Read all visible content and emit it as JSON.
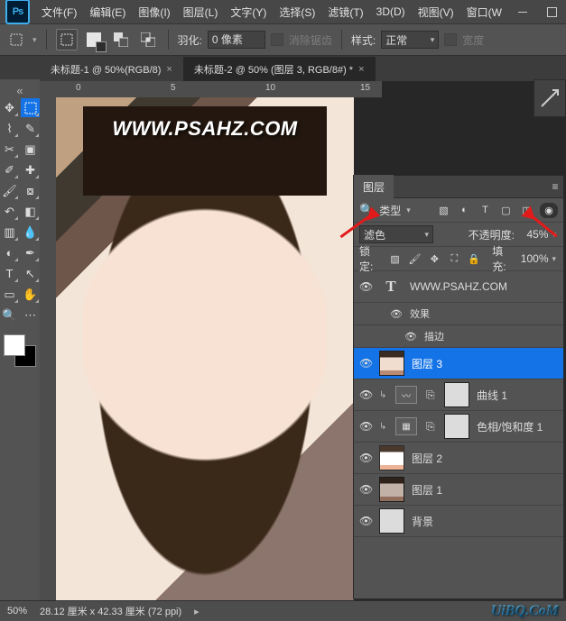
{
  "menubar": {
    "ps": "Ps",
    "items": [
      "文件(F)",
      "编辑(E)",
      "图像(I)",
      "图层(L)",
      "文字(Y)",
      "选择(S)",
      "滤镜(T)",
      "3D(D)",
      "视图(V)",
      "窗口(W"
    ]
  },
  "optbar": {
    "feather_label": "羽化:",
    "feather_value": "0 像素",
    "antialias": "消除锯齿",
    "style_label": "样式:",
    "style_value": "正常",
    "width_label": "宽度"
  },
  "tabs": {
    "t1": "未标题-1 @ 50%(RGB/8)",
    "t2": "未标题-2 @ 50% (图层 3, RGB/8#) *"
  },
  "ruler_h": [
    "0",
    "5",
    "10",
    "15"
  ],
  "watermark": "WWW.PSAHZ.COM",
  "toolbox_tip": "«",
  "layers_panel": {
    "title": "图层",
    "filter_label": "类型",
    "blend": "滤色",
    "opacity_label": "不透明度:",
    "opacity_value": "45%",
    "lock_label": "锁定:",
    "fill_label": "填充:",
    "fill_value": "100%"
  },
  "layers": {
    "l1": "WWW.PSAHZ.COM",
    "l1a": "效果",
    "l1b": "描边",
    "l2": "图层 3",
    "l3": "曲线 1",
    "l4": "色相/饱和度 1",
    "l5": "图层 2",
    "l6": "图层 1",
    "l7": "背景"
  },
  "status": {
    "zoom": "50%",
    "info": "28.12 厘米 x 42.33 厘米 (72 ppi)"
  },
  "brand": "UiBQ.CoM",
  "icons": {
    "search": "🔍",
    "eye": "👁",
    "lock": "🔒",
    "menu": "≡",
    "tri": "▸",
    "tridown": "▾",
    "circleT": "T",
    "fx": "fx",
    "chev": "▸",
    "bullet": "◦",
    "chain": "🔗"
  }
}
